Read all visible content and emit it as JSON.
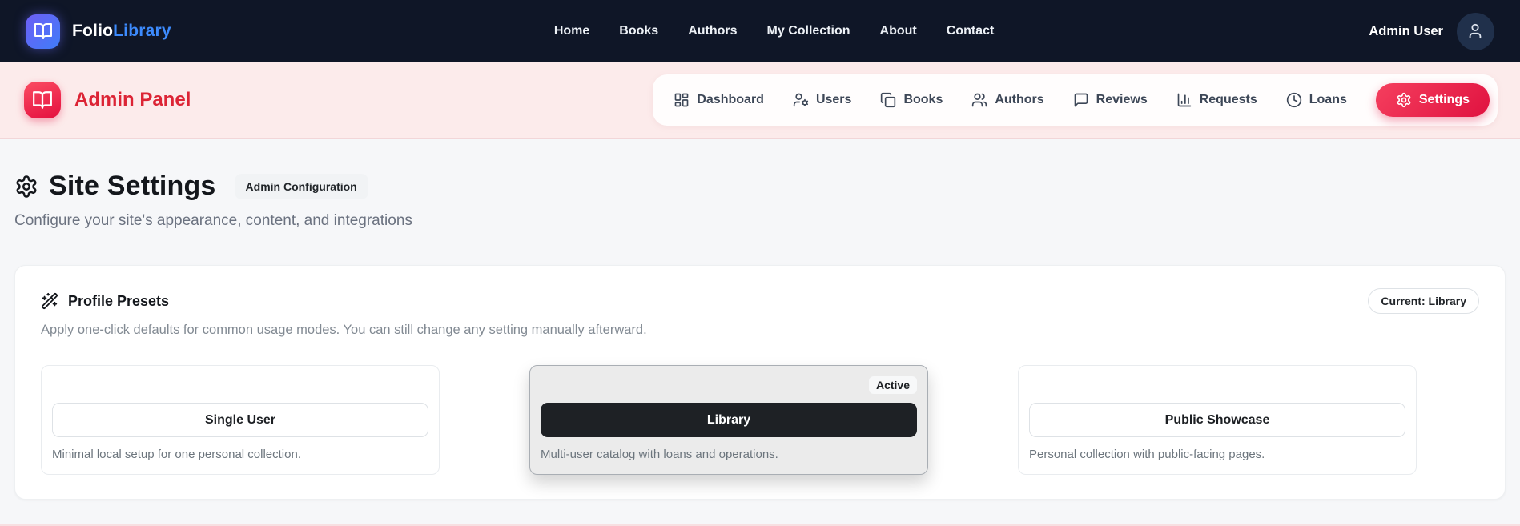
{
  "navbar": {
    "brand": {
      "text_primary": "Folio",
      "text_secondary": "Library",
      "icon": "book-open-icon"
    },
    "links": [
      {
        "label": "Home"
      },
      {
        "label": "Books"
      },
      {
        "label": "Authors"
      },
      {
        "label": "My Collection"
      },
      {
        "label": "About"
      },
      {
        "label": "Contact"
      }
    ],
    "user": {
      "name": "Admin User",
      "icon": "user-icon"
    }
  },
  "admin_bar": {
    "title": "Admin Panel",
    "icon": "book-open-icon",
    "tabs": [
      {
        "label": "Dashboard",
        "icon": "layout-dashboard-icon",
        "active": false
      },
      {
        "label": "Users",
        "icon": "user-cog-icon",
        "active": false
      },
      {
        "label": "Books",
        "icon": "book-copy-icon",
        "active": false
      },
      {
        "label": "Authors",
        "icon": "users-icon",
        "active": false
      },
      {
        "label": "Reviews",
        "icon": "message-square-icon",
        "active": false
      },
      {
        "label": "Requests",
        "icon": "bar-chart-icon",
        "active": false
      },
      {
        "label": "Loans",
        "icon": "clock-icon",
        "active": false
      },
      {
        "label": "Settings",
        "icon": "gear-icon",
        "active": true
      }
    ]
  },
  "page": {
    "title": "Site Settings",
    "title_icon": "gear-icon",
    "badge": "Admin Configuration",
    "subtitle": "Configure your site's appearance, content, and integrations"
  },
  "profile_presets": {
    "icon": "wand-sparkles-icon",
    "title": "Profile Presets",
    "current_badge": "Current: Library",
    "description": "Apply one-click defaults for common usage modes. You can still change any setting manually afterward.",
    "active_badge_label": "Active",
    "presets": [
      {
        "name": "Single User",
        "description": "Minimal local setup for one personal collection.",
        "active": false
      },
      {
        "name": "Library",
        "description": "Multi-user catalog with loans and operations.",
        "active": true
      },
      {
        "name": "Public Showcase",
        "description": "Personal collection with public-facing pages.",
        "active": false
      }
    ]
  },
  "colors": {
    "navbar_bg": "#0f1627",
    "brand_blue": "#3d8bfd",
    "brand_gradient_start": "#6e5ef6",
    "admin_bar_bg": "#fcebeb",
    "admin_red": "#dc2435",
    "accent_red": "#e01240",
    "page_bg": "#f6f7f9",
    "active_preset_bg": "#ebebeb",
    "active_button_bg": "#1e2125"
  }
}
